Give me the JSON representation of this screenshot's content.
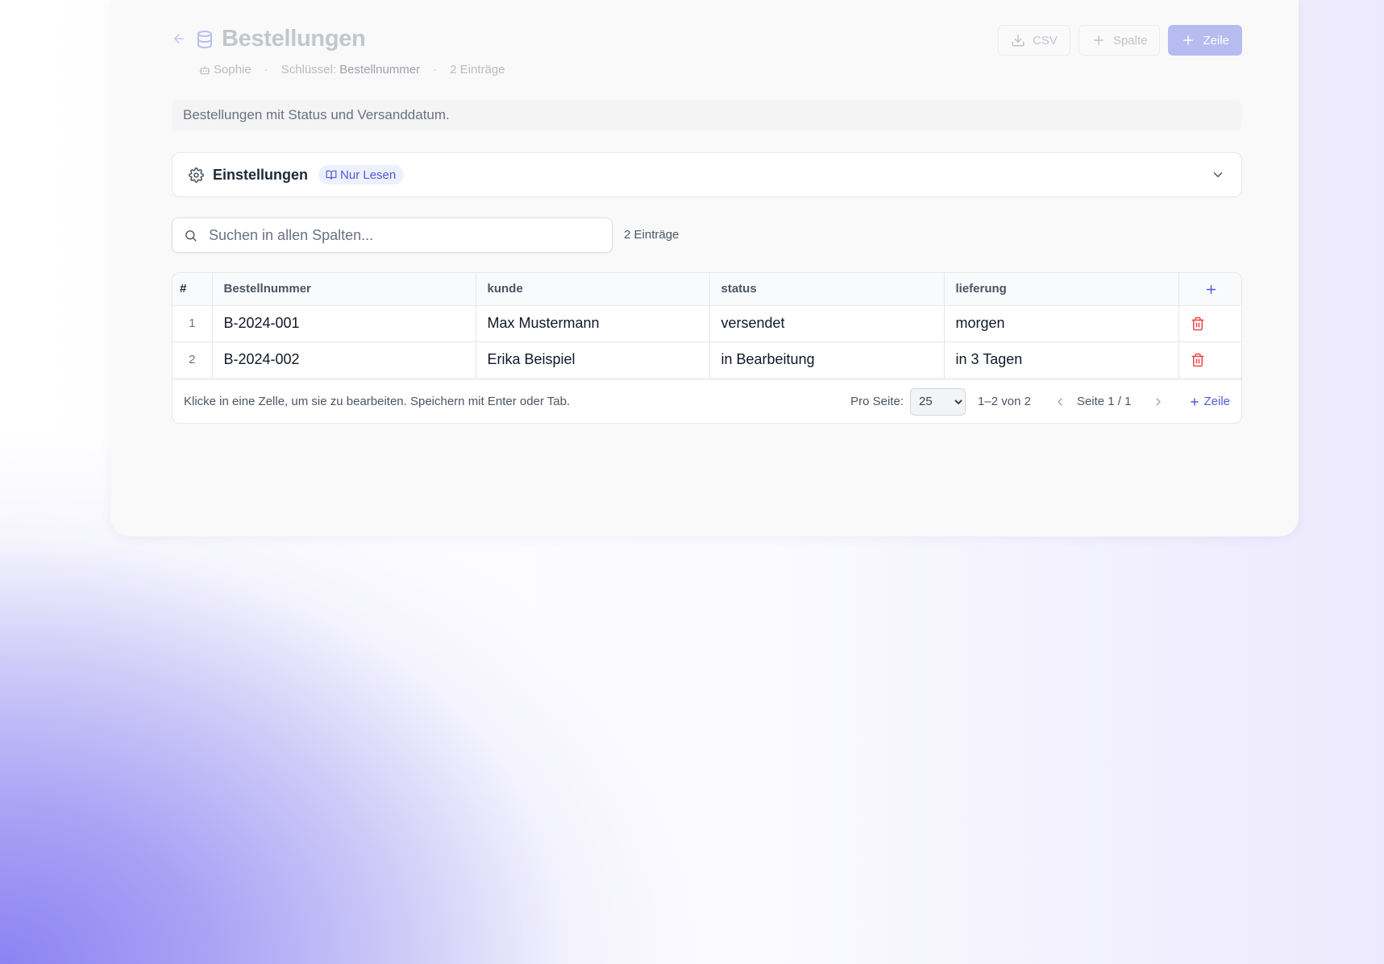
{
  "header": {
    "title": "Bestellungen",
    "owner": "Sophie",
    "key_label": "Schlüssel:",
    "key_value": "Bestellnummer",
    "entry_count": "2 Einträge",
    "separator": "·"
  },
  "actions": {
    "csv_label": "CSV",
    "add_column_label": "Spalte",
    "add_row_label": "Zeile"
  },
  "description": "Bestellungen mit Status und Versanddatum.",
  "settings": {
    "label": "Einstellungen",
    "badge": "Nur Lesen"
  },
  "search": {
    "placeholder": "Suchen in allen Spalten...",
    "value": "",
    "count": "2 Einträge"
  },
  "table": {
    "columns": [
      "#",
      "Bestellnummer",
      "kunde",
      "status",
      "lieferung"
    ],
    "rows": [
      {
        "index": "1",
        "cells": [
          "B-2024-001",
          "Max Mustermann",
          "versendet",
          "morgen"
        ]
      },
      {
        "index": "2",
        "cells": [
          "B-2024-002",
          "Erika Beispiel",
          "in Bearbeitung",
          "in 3 Tagen"
        ]
      }
    ]
  },
  "footer": {
    "hint": "Klicke in eine Zelle, um sie zu bearbeiten. Speichern mit Enter oder Tab.",
    "per_page_label": "Pro Seite:",
    "per_page_value": "25",
    "range": "1–2 von 2",
    "page_info": "Seite 1 / 1",
    "add_row_label": "Zeile"
  },
  "colors": {
    "accent": "#4f5bd5",
    "primary_button_disabled": "#b6bbf0",
    "danger": "#ef4444",
    "badge_bg": "#eef0ff"
  },
  "icons": {
    "back": "arrow-left-icon",
    "database": "database-icon",
    "owner": "bot-icon",
    "csv": "download-icon",
    "add": "plus-icon",
    "settings": "gear-icon",
    "badge": "book-open-icon",
    "expand": "chevron-down-icon",
    "search": "search-icon",
    "delete": "trash-icon",
    "prev": "chevron-left-icon",
    "next": "chevron-right-icon"
  }
}
